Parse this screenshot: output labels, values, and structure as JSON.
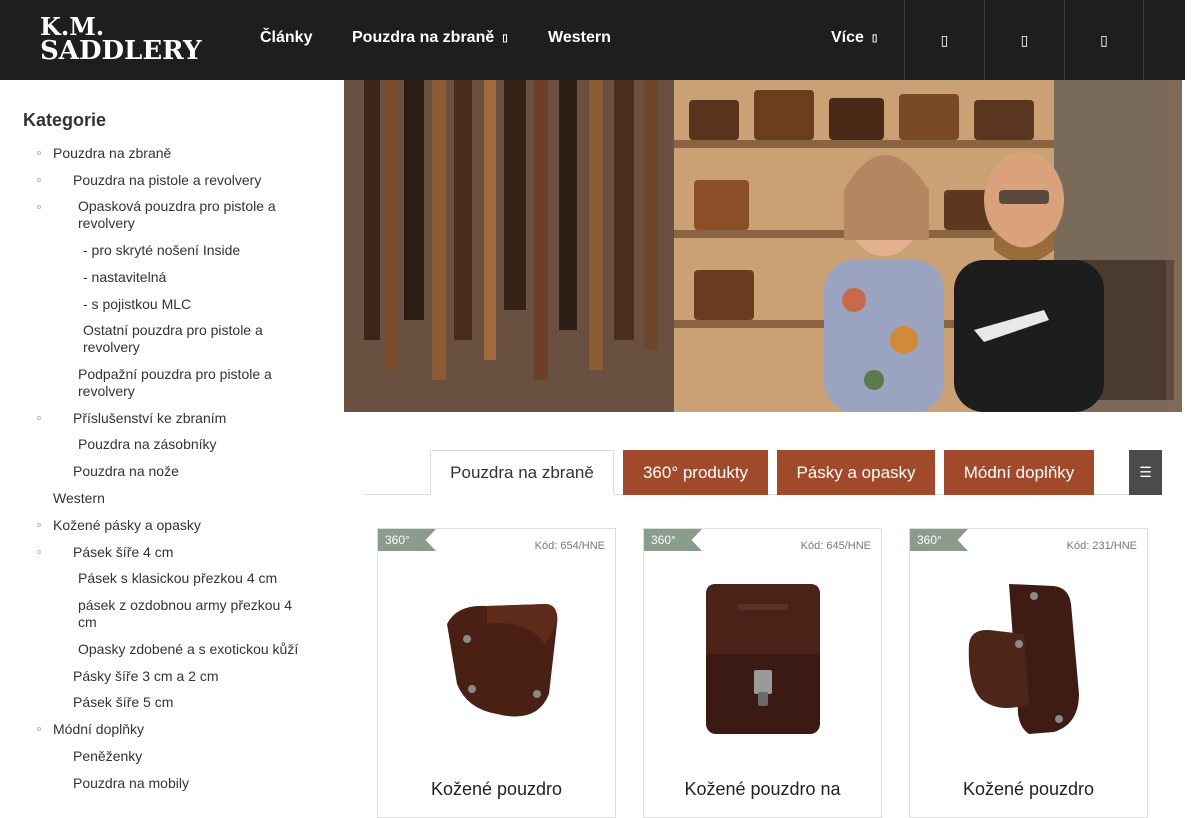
{
  "header": {
    "logo_line1": "K.M.",
    "logo_line2": "SADDLERY",
    "nav": [
      {
        "label": "Články"
      },
      {
        "label": "Pouzdra na zbraně"
      },
      {
        "label": "Western"
      },
      {
        "label": "Více"
      }
    ]
  },
  "sidebar": {
    "title": "Kategorie",
    "items": [
      {
        "label": "Pouzdra na zbraně"
      },
      {
        "label": "Pouzdra na pistole a revolvery"
      },
      {
        "label": "Opasková pouzdra pro pistole a revolvery"
      },
      {
        "label": "- pro skryté nošení Inside"
      },
      {
        "label": "- nastavitelná"
      },
      {
        "label": "- s pojistkou MLC"
      },
      {
        "label": "Ostatní pouzdra pro pistole a revolvery"
      },
      {
        "label": "Podpažní pouzdra pro pistole a revolvery"
      },
      {
        "label": "Příslušenství ke zbraním"
      },
      {
        "label": "Pouzdra na zásobníky"
      },
      {
        "label": "Pouzdra na nože"
      },
      {
        "label": "Western"
      },
      {
        "label": "Kožené pásky a opasky"
      },
      {
        "label": "Pásek šíře 4 cm"
      },
      {
        "label": "Pásek s klasickou přezkou 4 cm"
      },
      {
        "label": "pásek z ozdobnou army přezkou 4 cm"
      },
      {
        "label": "Opasky zdobené a s exotickou kůží"
      },
      {
        "label": "Pásky šíře 3 cm a 2 cm"
      },
      {
        "label": "Pásek šíře 5 cm"
      },
      {
        "label": "Módní doplňky"
      },
      {
        "label": "Peněženky"
      },
      {
        "label": "Pouzdra na mobily"
      }
    ]
  },
  "tabs": [
    {
      "label": "Pouzdra na zbraně"
    },
    {
      "label": "360° produkty"
    },
    {
      "label": "Pásky a opasky"
    },
    {
      "label": "Módní doplňky"
    }
  ],
  "tab_menu_label": "☰",
  "products": [
    {
      "badge": "360°",
      "code": "Kód: 654/HNE",
      "title": "Kožené pouzdro"
    },
    {
      "badge": "360°",
      "code": "Kód: 645/HNE",
      "title": "Kožené pouzdro na"
    },
    {
      "badge": "360°",
      "code": "Kód: 231/HNE",
      "title": "Kožené pouzdro"
    }
  ],
  "colors": {
    "header_bg": "#1e1e1e",
    "accent": "#a14a2b",
    "badge": "#8a9c8c"
  }
}
